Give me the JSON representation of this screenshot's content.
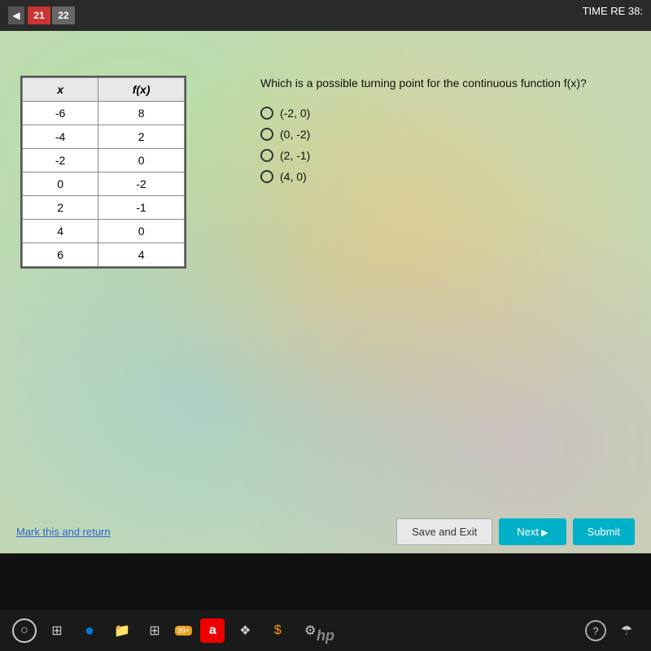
{
  "topbar": {
    "nav_arrow": "◀",
    "page_numbers": [
      "21",
      "22"
    ],
    "timer_label": "TIME RE",
    "timer_value": "38:"
  },
  "table": {
    "headers": [
      "x",
      "f(x)"
    ],
    "rows": [
      [
        "-6",
        "8"
      ],
      [
        "-4",
        "2"
      ],
      [
        "-2",
        "0"
      ],
      [
        "0",
        "-2"
      ],
      [
        "2",
        "-1"
      ],
      [
        "4",
        "0"
      ],
      [
        "6",
        "4"
      ]
    ]
  },
  "question": {
    "text": "Which is a possible turning point for the continuous function f(x)?",
    "options": [
      "(-2, 0)",
      "(0, -2)",
      "(2, -1)",
      "(4, 0)"
    ]
  },
  "buttons": {
    "mark_return": "Mark this and return",
    "save_exit": "Save and Exit",
    "next": "Next",
    "submit": "Submit"
  },
  "taskbar": {
    "icons": [
      "○",
      "⊞",
      "e",
      "📁",
      "⊞",
      "99+",
      "a",
      "❖",
      "S",
      "⚙",
      "?",
      "☂"
    ]
  }
}
